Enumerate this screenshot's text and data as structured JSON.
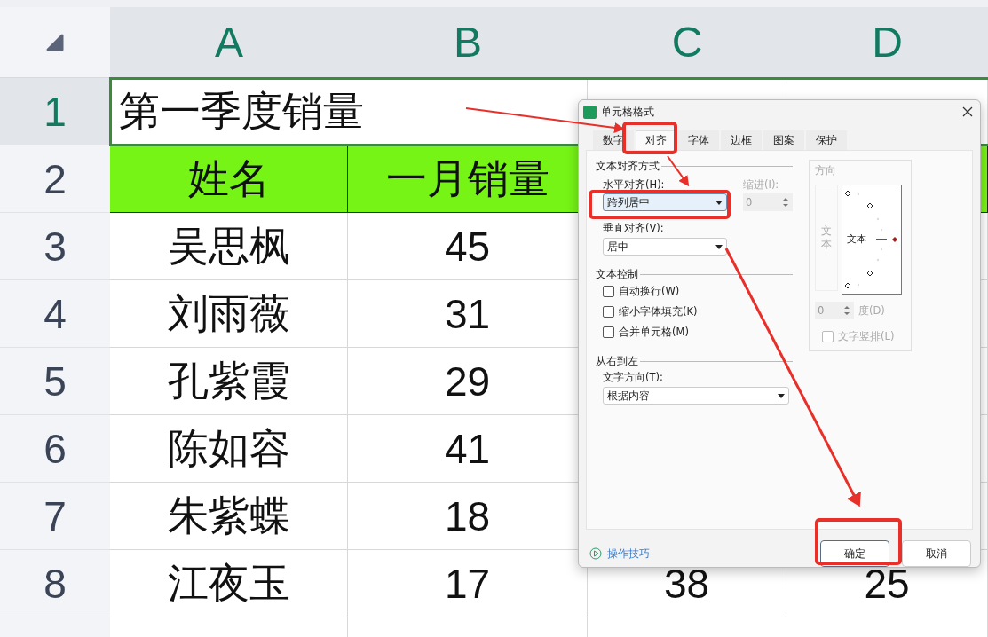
{
  "sheet": {
    "columns": [
      "A",
      "B",
      "C",
      "D"
    ],
    "rows": [
      {
        "number": "1",
        "selected": true,
        "kind": "title",
        "cells": [
          "第一季度销量",
          null,
          null,
          null
        ]
      },
      {
        "number": "2",
        "selected": false,
        "kind": "header",
        "cells": [
          "姓名",
          "一月销量",
          null,
          null
        ]
      },
      {
        "number": "3",
        "selected": false,
        "kind": "data",
        "cells": [
          "吴思枫",
          "45",
          null,
          null
        ]
      },
      {
        "number": "4",
        "selected": false,
        "kind": "data",
        "cells": [
          "刘雨薇",
          "31",
          null,
          null
        ]
      },
      {
        "number": "5",
        "selected": false,
        "kind": "data",
        "cells": [
          "孔紫霞",
          "29",
          null,
          null
        ]
      },
      {
        "number": "6",
        "selected": false,
        "kind": "data",
        "cells": [
          "陈如容",
          "41",
          null,
          null
        ]
      },
      {
        "number": "7",
        "selected": false,
        "kind": "data",
        "cells": [
          "朱紫蝶",
          "18",
          null,
          null
        ]
      },
      {
        "number": "8",
        "selected": false,
        "kind": "data",
        "cells": [
          "江夜玉",
          "17",
          "38",
          "25"
        ]
      }
    ]
  },
  "dialog": {
    "title": "单元格格式",
    "tabs": [
      {
        "label": "数字",
        "selected": false
      },
      {
        "label": "对齐",
        "selected": true
      },
      {
        "label": "字体",
        "selected": false
      },
      {
        "label": "边框",
        "selected": false
      },
      {
        "label": "图案",
        "selected": false
      },
      {
        "label": "保护",
        "selected": false
      }
    ],
    "alignment": {
      "heading": "文本对齐方式",
      "horizontal_label": "水平对齐(H):",
      "horizontal_value": "跨列居中",
      "indent": {
        "label": "缩进(I):",
        "value": "0",
        "disabled": true
      },
      "vertical_label": "垂直对齐(V):",
      "vertical_value": "居中"
    },
    "text_control": {
      "heading": "文本控制",
      "options": [
        {
          "label": "自动换行(W)",
          "checked": false
        },
        {
          "label": "缩小字体填充(K)",
          "checked": false
        },
        {
          "label": "合并单元格(M)",
          "checked": false
        }
      ]
    },
    "right_to_left": {
      "heading": "从右到左",
      "direction_label": "文字方向(T):",
      "direction_value": "根据内容"
    },
    "orientation": {
      "heading": "方向",
      "disabled": true,
      "vertical_text": "文本",
      "horizontal_text": "文本",
      "degrees_value": "0",
      "degrees_label": "度(D)",
      "stacked_label": "文字竖排(L)",
      "stacked_checked": false
    },
    "tips_link": "操作技巧",
    "buttons": [
      {
        "label": "确定",
        "primary": true
      },
      {
        "label": "取消",
        "primary": false
      }
    ]
  }
}
